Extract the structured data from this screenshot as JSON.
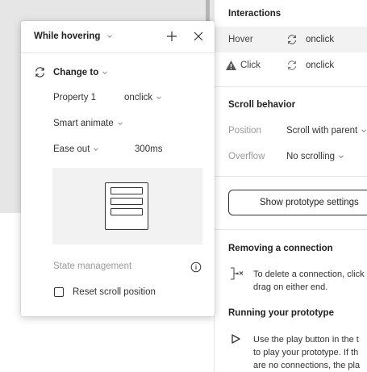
{
  "popover": {
    "title": "While hovering",
    "action": "Change to",
    "property_label": "Property 1",
    "property_value": "onclick",
    "animation": "Smart animate",
    "easing": "Ease out",
    "duration": "300ms",
    "state_management_label": "State management",
    "reset_scroll_label": "Reset scroll position",
    "reset_scroll_checked": false
  },
  "panel": {
    "interactions_title": "Interactions",
    "interactions": [
      {
        "trigger": "Hover",
        "target": "onclick",
        "warning": false
      },
      {
        "trigger": "Click",
        "target": "onclick",
        "warning": true
      }
    ],
    "scroll_title": "Scroll behavior",
    "position_label": "Position",
    "position_value": "Scroll with parent",
    "overflow_label": "Overflow",
    "overflow_value": "No scrolling",
    "show_settings_button": "Show prototype settings",
    "removing_title": "Removing a connection",
    "removing_text_1": "To delete a connection, click",
    "removing_text_2": "drag on either end.",
    "running_title": "Running your prototype",
    "running_text_1": "Use the play button in the t",
    "running_text_2": "to play your prototype. If th",
    "running_text_3": "are no connections, the pla"
  },
  "colors": {
    "canvas": "#e6e6e6",
    "hover_row": "#f2f2f2",
    "text": "#333333",
    "muted": "#9a9a9a"
  }
}
